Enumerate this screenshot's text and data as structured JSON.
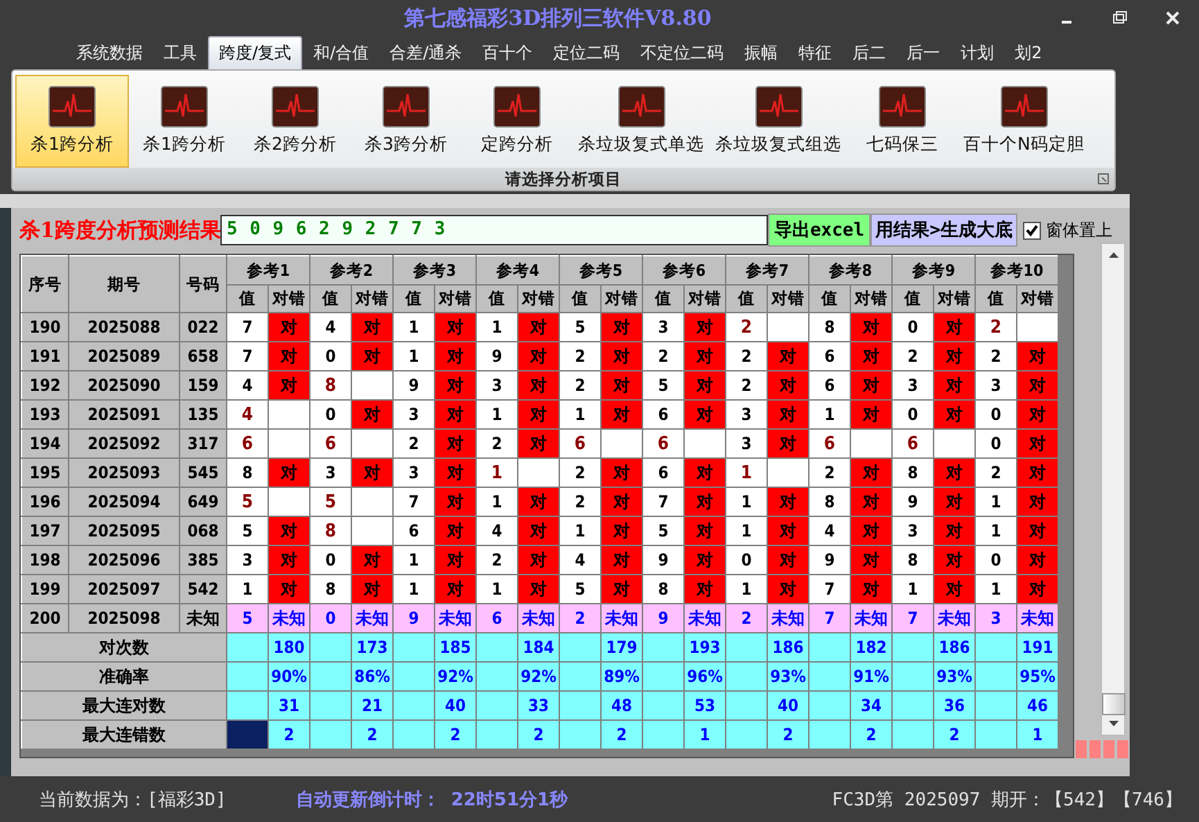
{
  "window": {
    "title": "第七感福彩3D排列三软件V8.80"
  },
  "menu_tabs": [
    {
      "label": "系统数据",
      "selected": false
    },
    {
      "label": "工具",
      "selected": false
    },
    {
      "label": "跨度/复式",
      "selected": true
    },
    {
      "label": "和/合值",
      "selected": false
    },
    {
      "label": "合差/通杀",
      "selected": false
    },
    {
      "label": "百十个",
      "selected": false
    },
    {
      "label": "定位二码",
      "selected": false
    },
    {
      "label": "不定位二码",
      "selected": false
    },
    {
      "label": "振幅",
      "selected": false
    },
    {
      "label": "特征",
      "selected": false
    },
    {
      "label": "后二",
      "selected": false
    },
    {
      "label": "后一",
      "selected": false
    },
    {
      "label": "计划",
      "selected": false
    },
    {
      "label": "划2",
      "selected": false
    }
  ],
  "ribbon": {
    "group_label": "请选择分析项目",
    "items": [
      {
        "label": "杀1跨分析",
        "selected": true
      },
      {
        "label": "杀1跨分析",
        "selected": false
      },
      {
        "label": "杀2跨分析",
        "selected": false
      },
      {
        "label": "杀3跨分析",
        "selected": false
      },
      {
        "label": "定跨分析",
        "selected": false
      },
      {
        "label": "杀垃圾复式单选",
        "selected": false
      },
      {
        "label": "杀垃圾复式组选",
        "selected": false
      },
      {
        "label": "七码保三",
        "selected": false
      },
      {
        "label": "百十个N码定胆",
        "selected": false
      }
    ]
  },
  "result": {
    "title": "杀1跨度分析预测结果",
    "digits": "5 0 9 6 2 9 2 7 7 3"
  },
  "buttons": [
    {
      "label": "导出excel",
      "kind": "export"
    },
    {
      "label": "用结果>生成大底",
      "kind": "generate"
    }
  ],
  "topmost_checkbox": {
    "label": "窗体置上",
    "checked": true
  },
  "table": {
    "columns": [
      "序号",
      "期号",
      "号码"
    ],
    "groups": [
      {
        "label": "参考1",
        "sub": [
          "值",
          "对错"
        ]
      },
      {
        "label": "参考2",
        "sub": [
          "值",
          "对错"
        ]
      },
      {
        "label": "参考3",
        "sub": [
          "值",
          "对错"
        ]
      },
      {
        "label": "参考4",
        "sub": [
          "值",
          "对错"
        ]
      },
      {
        "label": "参考5",
        "sub": [
          "值",
          "对错"
        ]
      },
      {
        "label": "参考6",
        "sub": [
          "值",
          "对错"
        ]
      },
      {
        "label": "参考7",
        "sub": [
          "值",
          "对错"
        ]
      },
      {
        "label": "参考8",
        "sub": [
          "值",
          "对错"
        ]
      },
      {
        "label": "参考9",
        "sub": [
          "值",
          "对错"
        ]
      },
      {
        "label": "参考10",
        "sub": [
          "值",
          "对错"
        ]
      }
    ],
    "rows": [
      {
        "index": "190",
        "issue": "2025088",
        "number": "022",
        "kind": "history",
        "cells": [
          {
            "value": "7",
            "hit": true,
            "result": "对"
          },
          {
            "value": "4",
            "hit": true,
            "result": "对"
          },
          {
            "value": "1",
            "hit": true,
            "result": "对"
          },
          {
            "value": "1",
            "hit": true,
            "result": "对"
          },
          {
            "value": "5",
            "hit": true,
            "result": "对"
          },
          {
            "value": "3",
            "hit": true,
            "result": "对"
          },
          {
            "value": "2",
            "hit": false
          },
          {
            "value": "8",
            "hit": true,
            "result": "对"
          },
          {
            "value": "0",
            "hit": true,
            "result": "对"
          },
          {
            "value": "2",
            "hit": false
          }
        ]
      },
      {
        "index": "191",
        "issue": "2025089",
        "number": "658",
        "kind": "history",
        "cells": [
          {
            "value": "7",
            "hit": true,
            "result": "对"
          },
          {
            "value": "0",
            "hit": true,
            "result": "对"
          },
          {
            "value": "1",
            "hit": true,
            "result": "对"
          },
          {
            "value": "9",
            "hit": true,
            "result": "对"
          },
          {
            "value": "2",
            "hit": true,
            "result": "对"
          },
          {
            "value": "2",
            "hit": true,
            "result": "对"
          },
          {
            "value": "2",
            "hit": true,
            "result": "对"
          },
          {
            "value": "6",
            "hit": true,
            "result": "对"
          },
          {
            "value": "2",
            "hit": true,
            "result": "对"
          },
          {
            "value": "2",
            "hit": true,
            "result": "对"
          }
        ]
      },
      {
        "index": "192",
        "issue": "2025090",
        "number": "159",
        "kind": "history",
        "cells": [
          {
            "value": "4",
            "hit": true,
            "result": "对"
          },
          {
            "value": "8",
            "hit": false
          },
          {
            "value": "9",
            "hit": true,
            "result": "对"
          },
          {
            "value": "3",
            "hit": true,
            "result": "对"
          },
          {
            "value": "2",
            "hit": true,
            "result": "对"
          },
          {
            "value": "5",
            "hit": true,
            "result": "对"
          },
          {
            "value": "2",
            "hit": true,
            "result": "对"
          },
          {
            "value": "6",
            "hit": true,
            "result": "对"
          },
          {
            "value": "3",
            "hit": true,
            "result": "对"
          },
          {
            "value": "3",
            "hit": true,
            "result": "对"
          }
        ]
      },
      {
        "index": "193",
        "issue": "2025091",
        "number": "135",
        "kind": "history",
        "cells": [
          {
            "value": "4",
            "hit": false
          },
          {
            "value": "0",
            "hit": true,
            "result": "对"
          },
          {
            "value": "3",
            "hit": true,
            "result": "对"
          },
          {
            "value": "1",
            "hit": true,
            "result": "对"
          },
          {
            "value": "1",
            "hit": true,
            "result": "对"
          },
          {
            "value": "6",
            "hit": true,
            "result": "对"
          },
          {
            "value": "3",
            "hit": true,
            "result": "对"
          },
          {
            "value": "1",
            "hit": true,
            "result": "对"
          },
          {
            "value": "0",
            "hit": true,
            "result": "对"
          },
          {
            "value": "0",
            "hit": true,
            "result": "对"
          }
        ]
      },
      {
        "index": "194",
        "issue": "2025092",
        "number": "317",
        "kind": "history",
        "cells": [
          {
            "value": "6",
            "hit": false
          },
          {
            "value": "6",
            "hit": false
          },
          {
            "value": "2",
            "hit": true,
            "result": "对"
          },
          {
            "value": "2",
            "hit": true,
            "result": "对"
          },
          {
            "value": "6",
            "hit": false
          },
          {
            "value": "6",
            "hit": false
          },
          {
            "value": "3",
            "hit": true,
            "result": "对"
          },
          {
            "value": "6",
            "hit": false
          },
          {
            "value": "6",
            "hit": false
          },
          {
            "value": "0",
            "hit": true,
            "result": "对"
          }
        ]
      },
      {
        "index": "195",
        "issue": "2025093",
        "number": "545",
        "kind": "history",
        "cells": [
          {
            "value": "8",
            "hit": true,
            "result": "对"
          },
          {
            "value": "3",
            "hit": true,
            "result": "对"
          },
          {
            "value": "3",
            "hit": true,
            "result": "对"
          },
          {
            "value": "1",
            "hit": false
          },
          {
            "value": "2",
            "hit": true,
            "result": "对"
          },
          {
            "value": "6",
            "hit": true,
            "result": "对"
          },
          {
            "value": "1",
            "hit": false
          },
          {
            "value": "2",
            "hit": true,
            "result": "对"
          },
          {
            "value": "8",
            "hit": true,
            "result": "对"
          },
          {
            "value": "2",
            "hit": true,
            "result": "对"
          }
        ]
      },
      {
        "index": "196",
        "issue": "2025094",
        "number": "649",
        "kind": "history",
        "cells": [
          {
            "value": "5",
            "hit": false
          },
          {
            "value": "5",
            "hit": false
          },
          {
            "value": "7",
            "hit": true,
            "result": "对"
          },
          {
            "value": "1",
            "hit": true,
            "result": "对"
          },
          {
            "value": "2",
            "hit": true,
            "result": "对"
          },
          {
            "value": "7",
            "hit": true,
            "result": "对"
          },
          {
            "value": "1",
            "hit": true,
            "result": "对"
          },
          {
            "value": "8",
            "hit": true,
            "result": "对"
          },
          {
            "value": "9",
            "hit": true,
            "result": "对"
          },
          {
            "value": "1",
            "hit": true,
            "result": "对"
          }
        ]
      },
      {
        "index": "197",
        "issue": "2025095",
        "number": "068",
        "kind": "history",
        "cells": [
          {
            "value": "5",
            "hit": true,
            "result": "对"
          },
          {
            "value": "8",
            "hit": false
          },
          {
            "value": "6",
            "hit": true,
            "result": "对"
          },
          {
            "value": "4",
            "hit": true,
            "result": "对"
          },
          {
            "value": "1",
            "hit": true,
            "result": "对"
          },
          {
            "value": "5",
            "hit": true,
            "result": "对"
          },
          {
            "value": "1",
            "hit": true,
            "result": "对"
          },
          {
            "value": "4",
            "hit": true,
            "result": "对"
          },
          {
            "value": "3",
            "hit": true,
            "result": "对"
          },
          {
            "value": "1",
            "hit": true,
            "result": "对"
          }
        ]
      },
      {
        "index": "198",
        "issue": "2025096",
        "number": "385",
        "kind": "history",
        "cells": [
          {
            "value": "3",
            "hit": true,
            "result": "对"
          },
          {
            "value": "0",
            "hit": true,
            "result": "对"
          },
          {
            "value": "1",
            "hit": true,
            "result": "对"
          },
          {
            "value": "2",
            "hit": true,
            "result": "对"
          },
          {
            "value": "4",
            "hit": true,
            "result": "对"
          },
          {
            "value": "9",
            "hit": true,
            "result": "对"
          },
          {
            "value": "0",
            "hit": true,
            "result": "对"
          },
          {
            "value": "9",
            "hit": true,
            "result": "对"
          },
          {
            "value": "8",
            "hit": true,
            "result": "对"
          },
          {
            "value": "0",
            "hit": true,
            "result": "对"
          }
        ]
      },
      {
        "index": "199",
        "issue": "2025097",
        "number": "542",
        "kind": "history",
        "cells": [
          {
            "value": "1",
            "hit": true,
            "result": "对"
          },
          {
            "value": "8",
            "hit": true,
            "result": "对"
          },
          {
            "value": "1",
            "hit": true,
            "result": "对"
          },
          {
            "value": "1",
            "hit": true,
            "result": "对"
          },
          {
            "value": "5",
            "hit": true,
            "result": "对"
          },
          {
            "value": "8",
            "hit": true,
            "result": "对"
          },
          {
            "value": "1",
            "hit": true,
            "result": "对"
          },
          {
            "value": "7",
            "hit": true,
            "result": "对"
          },
          {
            "value": "1",
            "hit": true,
            "result": "对"
          },
          {
            "value": "1",
            "hit": true,
            "result": "对"
          }
        ]
      },
      {
        "index": "200",
        "issue": "2025098",
        "number": "未知",
        "kind": "pending",
        "cells": [
          {
            "value": "5",
            "result": "未知"
          },
          {
            "value": "0",
            "result": "未知"
          },
          {
            "value": "9",
            "result": "未知"
          },
          {
            "value": "6",
            "result": "未知"
          },
          {
            "value": "2",
            "result": "未知"
          },
          {
            "value": "9",
            "result": "未知"
          },
          {
            "value": "2",
            "result": "未知"
          },
          {
            "value": "7",
            "result": "未知"
          },
          {
            "value": "7",
            "result": "未知"
          },
          {
            "value": "3",
            "result": "未知"
          }
        ]
      }
    ],
    "stats": [
      {
        "label": "对次数",
        "selected": false,
        "values": [
          "180",
          "173",
          "185",
          "184",
          "179",
          "193",
          "186",
          "182",
          "186",
          "191"
        ]
      },
      {
        "label": "准确率",
        "selected": false,
        "values": [
          "90%",
          "86%",
          "92%",
          "92%",
          "89%",
          "96%",
          "93%",
          "91%",
          "93%",
          "95%"
        ]
      },
      {
        "label": "最大连对数",
        "selected": false,
        "values": [
          "31",
          "21",
          "40",
          "33",
          "48",
          "53",
          "40",
          "34",
          "36",
          "46"
        ]
      },
      {
        "label": "最大连错数",
        "selected": true,
        "values": [
          "2",
          "2",
          "2",
          "2",
          "2",
          "1",
          "2",
          "2",
          "2",
          "1"
        ]
      }
    ]
  },
  "status_bar": {
    "current_data": "当前数据为：[福彩3D]",
    "countdown_label": "自动更新倒计时：",
    "countdown": "22时51分1秒",
    "draw_info": "FC3D第 2025097 期开：【542】【746】"
  }
}
